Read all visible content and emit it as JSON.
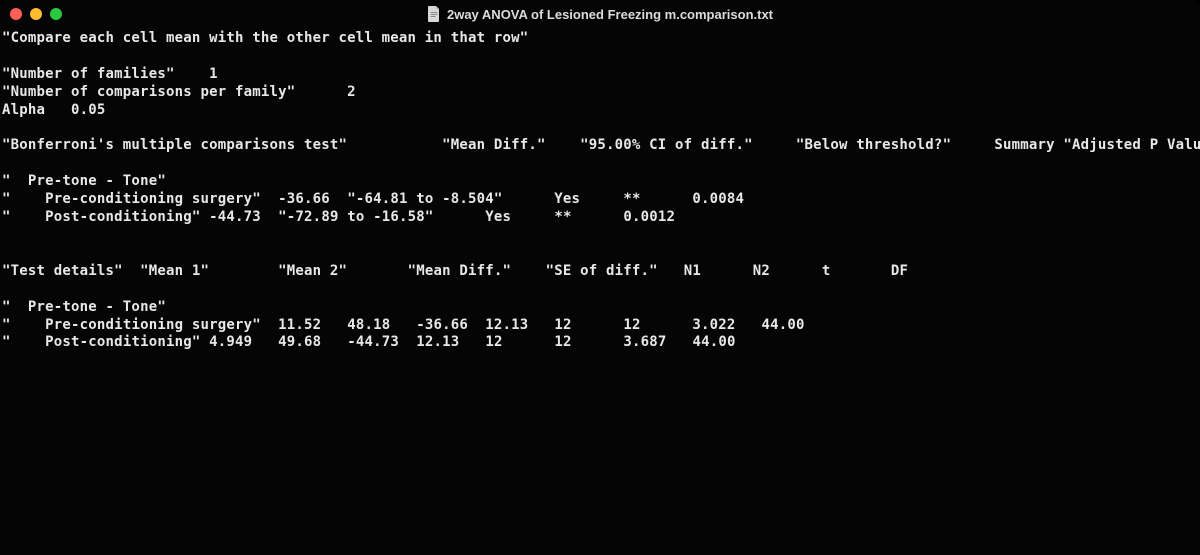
{
  "window": {
    "title": "2way ANOVA of Lesioned Freezing m.comparison.txt"
  },
  "header": {
    "compare_line": "\"Compare each cell mean with the other cell mean in that row\"",
    "num_families_label": "\"Number of families\"",
    "num_families_value": "1",
    "num_comparisons_label": "\"Number of comparisons per family\"",
    "num_comparisons_value": "2",
    "alpha_label": "Alpha",
    "alpha_value": "0.05"
  },
  "bonf": {
    "test_label": "\"Bonferroni's multiple comparisons test\"",
    "col_mean_diff": "\"Mean Diff.\"",
    "col_ci": "\"95.00% CI of diff.\"",
    "col_below": "\"Below threshold?\"",
    "col_summary": "Summary",
    "col_adjp": "\"Adjusted P Value\"",
    "group_label": "Pre-tone - Tone\"",
    "rows": [
      {
        "label": "Pre-conditioning surgery\"",
        "mean_diff": "-36.66",
        "ci": "\"-64.81 to -8.504\"",
        "below": "Yes",
        "stars": "**",
        "adjp": "0.0084"
      },
      {
        "label": "Post-conditioning\"",
        "mean_diff": "-44.73",
        "ci": "\"-72.89 to -16.58\"",
        "below": "Yes",
        "stars": "**",
        "adjp": "0.0012"
      }
    ]
  },
  "details": {
    "test_label": "\"Test details\"",
    "col_mean1": "\"Mean 1\"",
    "col_mean2": "\"Mean 2\"",
    "col_mean_diff": "\"Mean Diff.\"",
    "col_se": "\"SE of diff.\"",
    "col_n1": "N1",
    "col_n2": "N2",
    "col_t": "t",
    "col_df": "DF",
    "group_label": "Pre-tone - Tone\"",
    "rows": [
      {
        "label": "Pre-conditioning surgery\"",
        "mean1": "11.52",
        "mean2": "48.18",
        "mean_diff": "-36.66",
        "se": "12.13",
        "n1": "12",
        "n2": "12",
        "t": "3.022",
        "df": "44.00"
      },
      {
        "label": "Post-conditioning\"",
        "mean1": "4.949",
        "mean2": "49.68",
        "mean_diff": "-44.73",
        "se": "12.13",
        "n1": "12",
        "n2": "12",
        "t": "3.687",
        "df": "44.00"
      }
    ]
  }
}
